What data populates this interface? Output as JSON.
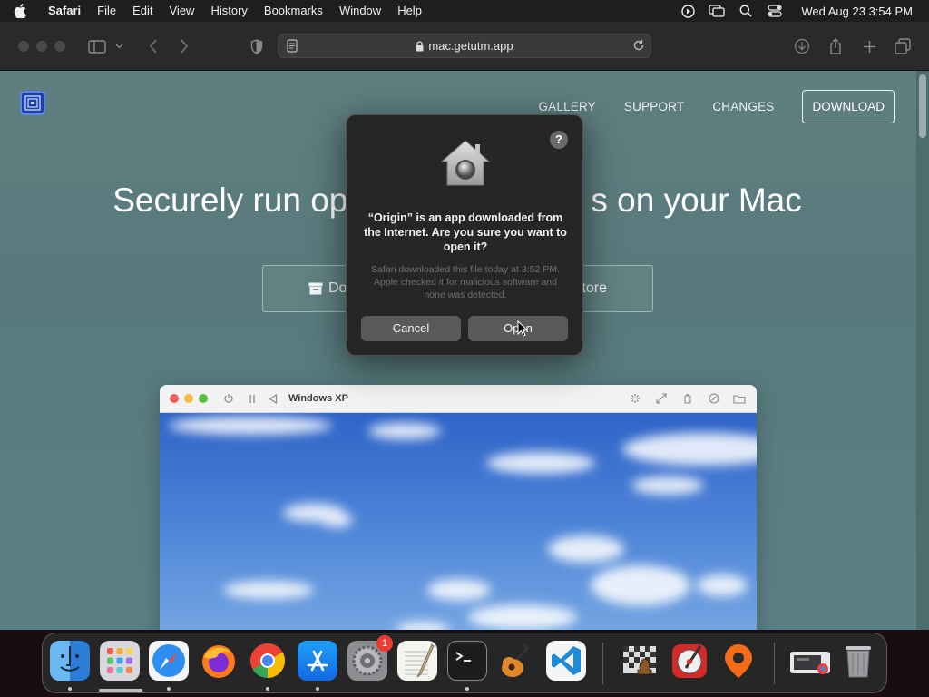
{
  "menubar": {
    "app_name": "Safari",
    "items": [
      "File",
      "Edit",
      "View",
      "History",
      "Bookmarks",
      "Window",
      "Help"
    ],
    "clock": "Wed Aug 23  3:54 PM",
    "status_icons": [
      "play-circle-icon",
      "screen-mirroring-icon",
      "spotlight-search-icon",
      "control-center-icon"
    ]
  },
  "toolbar": {
    "url": "mac.getutm.app",
    "icons": [
      "sidebar-icon",
      "chevron-down-icon",
      "back-icon",
      "forward-icon",
      "privacy-shield-icon",
      "downloads-icon",
      "share-icon",
      "new-tab-icon",
      "tab-overview-icon"
    ]
  },
  "site": {
    "nav": {
      "gallery": "GALLERY",
      "support": "SUPPORT",
      "changes": "CHANGES",
      "download": "DOWNLOAD"
    },
    "hero_left": "Securely run op",
    "hero_right": "s on your Mac",
    "download_button_partial": "Do",
    "appstore_button_partial": "tore",
    "vm_window_title": "Windows XP"
  },
  "dialog": {
    "heading": "“Origin” is an app downloaded from the Internet. Are you sure you want to open it?",
    "info": "Safari downloaded this file today at 3:52 PM. Apple checked it for malicious software and none was detected.",
    "cancel_label": "Cancel",
    "open_label": "Open",
    "help_label": "?"
  },
  "dock": {
    "apps": [
      "Finder",
      "Launchpad",
      "Safari",
      "Firefox",
      "Chrome",
      "App Store",
      "System Settings",
      "TextEdit",
      "Terminal",
      "GarageBand",
      "Visual Studio Code",
      "Chess",
      "Xcode Instruments",
      "Origin",
      "Downloads",
      "Trash"
    ],
    "settings_badge": "1"
  },
  "colors": {
    "accent_blue": "#1c3fa8",
    "badge_red": "#ec3b33",
    "page_bg": "#5f7e80"
  }
}
